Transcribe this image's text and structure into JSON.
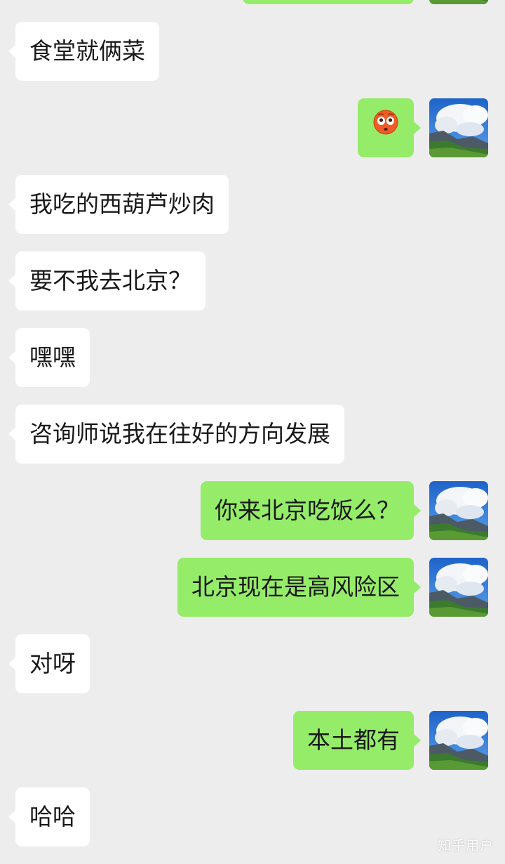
{
  "conversation": {
    "messages": [
      {
        "side": "out",
        "text": ""
      },
      {
        "side": "in",
        "text": "食堂就俩菜"
      },
      {
        "side": "out",
        "emoji": "flushed-face-icon",
        "text": ""
      },
      {
        "side": "in",
        "text": "我吃的西葫芦炒肉"
      },
      {
        "side": "in",
        "text": "要不我去北京？"
      },
      {
        "side": "in",
        "text": "嘿嘿"
      },
      {
        "side": "in",
        "text": "咨询师说我在往好的方向发展"
      },
      {
        "side": "out",
        "text": "你来北京吃饭么？"
      },
      {
        "side": "out",
        "text": "北京现在是高风险区"
      },
      {
        "side": "in",
        "text": "对呀"
      },
      {
        "side": "out",
        "text": "本土都有"
      },
      {
        "side": "in",
        "text": "哈哈"
      }
    ]
  },
  "colors": {
    "background": "#ededed",
    "incoming_bubble": "#ffffff",
    "outgoing_bubble": "#95ec69"
  },
  "watermark": {
    "text": "知乎用户"
  }
}
